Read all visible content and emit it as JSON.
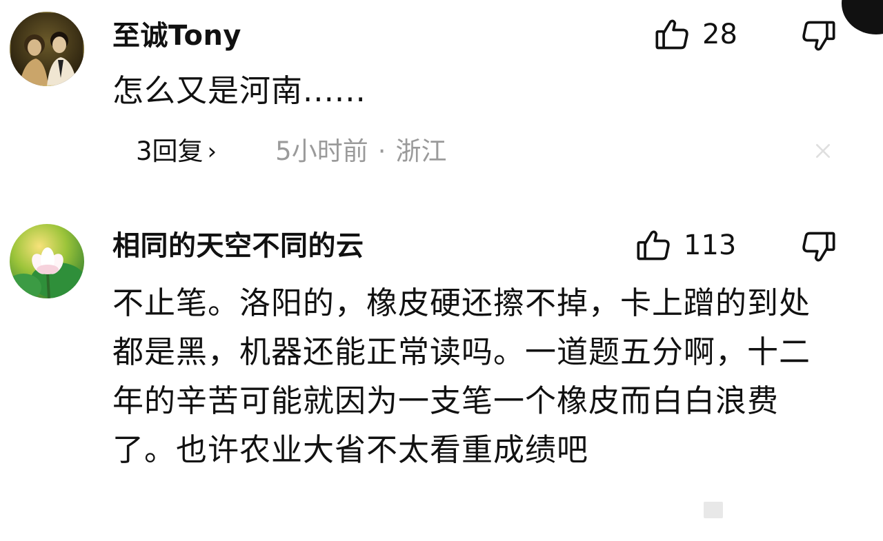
{
  "comments": [
    {
      "username": "至诚Tony",
      "text": "怎么又是河南......",
      "likes": "28",
      "replies_label": "3回复",
      "chevron": "›",
      "time": "5小时前",
      "separator": "·",
      "location": "浙江",
      "avatar_icon": "portrait-photo-avatar"
    },
    {
      "username": "相同的天空不同的云",
      "text": "不止笔。洛阳的，橡皮硬还擦不掉，卡上蹭的到处都是黑，机器还能正常读吗。一道题五分啊，十二年的辛苦可能就因为一支笔一个橡皮而白白浪费了。也许农业大省不太看重成绩吧",
      "likes": "113",
      "avatar_icon": "lotus-flower-avatar"
    }
  ],
  "icons": {
    "like": "thumbs-up-icon",
    "dislike": "thumbs-down-icon",
    "close": "close-icon"
  },
  "colors": {
    "text": "#111111",
    "meta_gray": "#9a9a9a",
    "background": "#ffffff"
  }
}
